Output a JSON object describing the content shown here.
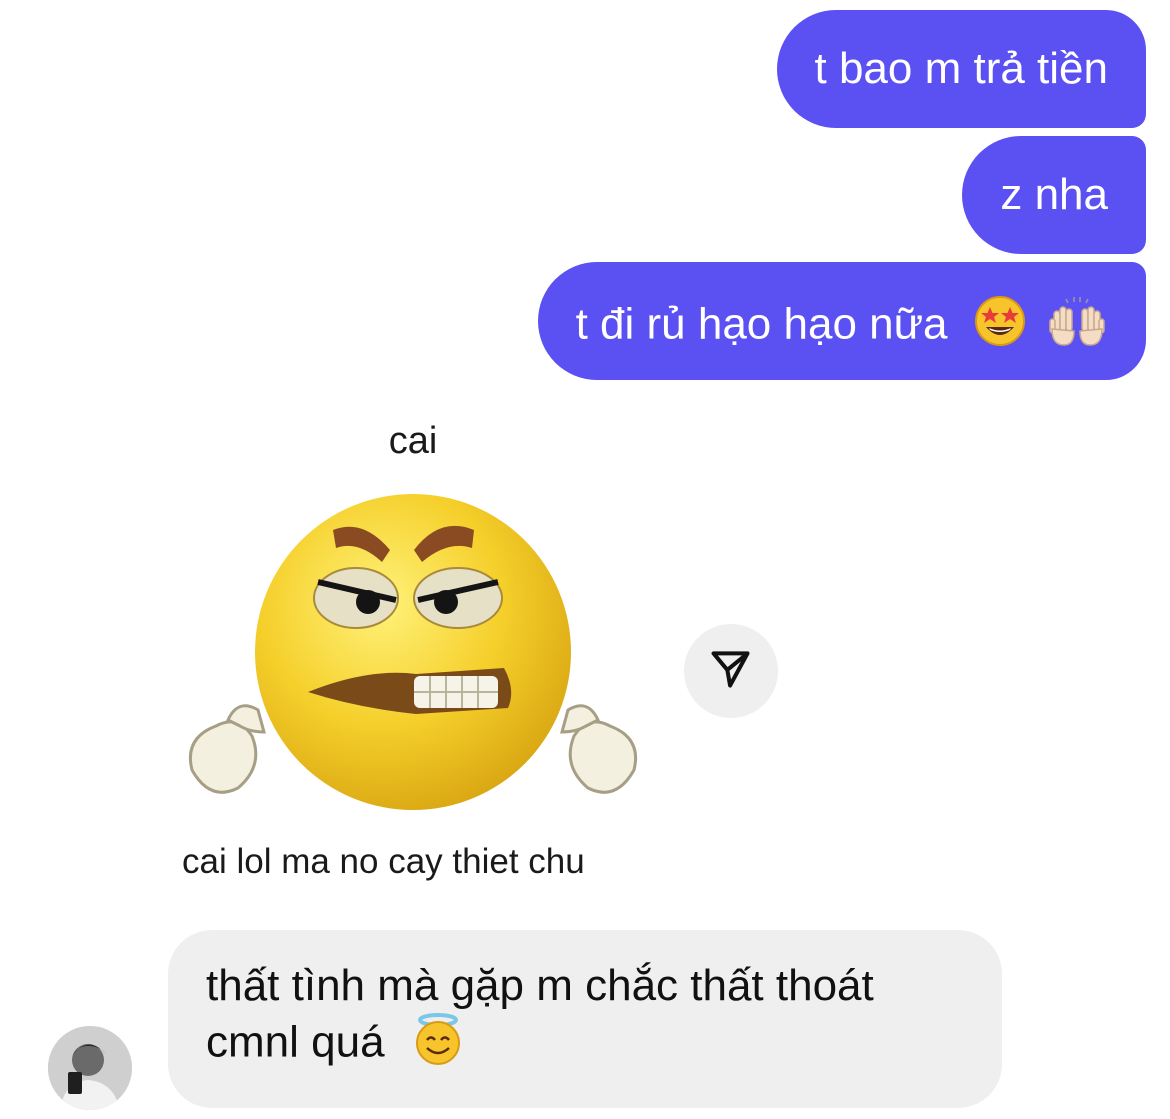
{
  "messages_out": [
    {
      "text": "t bao m trả tiền"
    },
    {
      "text": "z nha"
    },
    {
      "text": "t đi rủ hạo hạo nữa",
      "emojis": [
        "star-struck-emoji",
        "raising-hands-emoji"
      ]
    }
  ],
  "sticker": {
    "top_text": "cai",
    "bottom_text": "cai lol ma no cay thiet chu",
    "icon": "angry-face-sticker"
  },
  "share": {
    "icon": "send-icon"
  },
  "message_in": {
    "line1": "thất tình mà gặp m chắc thất thoát",
    "line2": "cmnl quá",
    "emoji": "halo-smiling-face-emoji"
  },
  "avatar": {
    "icon": "user-avatar"
  },
  "colors": {
    "outgoing_bubble": "#5b51f3",
    "incoming_bubble": "#efefef",
    "background": "#ffffff"
  }
}
